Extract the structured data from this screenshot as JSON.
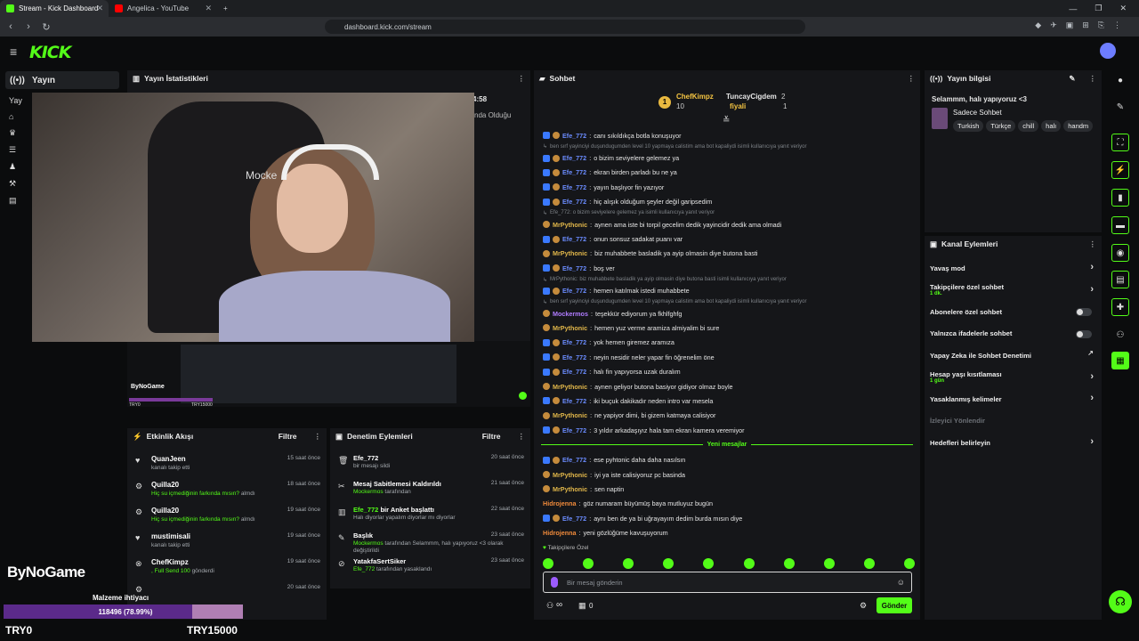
{
  "browser": {
    "tabs": [
      {
        "title": "Stream - Kick Dashboard",
        "color": "#53fc18"
      },
      {
        "title": "Angelica - YouTube",
        "color": "#ff0000"
      }
    ],
    "url": "dashboard.kick.com/stream"
  },
  "header": {
    "logo": "KICK"
  },
  "leftnav": {
    "active": "Yayın",
    "label": "Yay"
  },
  "stats": {
    "title": "Yayın İstatistikleri",
    "time": "4:58",
    "partial_label": "nda Olduğu"
  },
  "preview": {
    "brand": "ByNoGame",
    "left": "TRY0",
    "right": "TRY15000"
  },
  "activity": {
    "title": "Etkinlik Akışı",
    "filter": "Filtre",
    "items": [
      {
        "icon": "heart-icon",
        "glyph": "♥",
        "name": "QuanJeen",
        "sub": "kanalı takip etti",
        "sub_green": "",
        "time": "15 saat önce"
      },
      {
        "icon": "gift-icon",
        "glyph": "⚙",
        "name": "Quilla20",
        "sub": "almdı",
        "sub_green": "Hiç su içmediğinin farkında mısın?",
        "time": "18 saat önce"
      },
      {
        "icon": "gift-icon",
        "glyph": "⚙",
        "name": "Quilla20",
        "sub": "almdı",
        "sub_green": "Hiç su içmediğinin farkında mısın?",
        "time": "19 saat önce"
      },
      {
        "icon": "heart-icon",
        "glyph": "♥",
        "name": "mustimisali",
        "sub": "kanalı takip etti",
        "sub_green": "",
        "time": "19 saat önce"
      },
      {
        "icon": "x-circle-icon",
        "glyph": "⊗",
        "name": "ChefKimpz",
        "sub": "gönderdi",
        "sub_green": ", Full Send",
        "coins": "100",
        "time": "19 saat önce"
      },
      {
        "icon": "gift-icon",
        "glyph": "⚙",
        "name": "",
        "sub": "",
        "sub_green": "",
        "time": "20 saat önce"
      }
    ]
  },
  "moderation": {
    "title": "Denetim Eylemleri",
    "filter": "Filtre",
    "items": [
      {
        "icon": "trash-icon",
        "glyph": "🗑",
        "name": "Efe_772",
        "name_green": "",
        "sub": "bir mesajı sildi",
        "sub_green": "",
        "time": "20 saat önce"
      },
      {
        "icon": "pin-off-icon",
        "glyph": "✂",
        "name": "Mesaj Sabitlemesi Kaldırıldı",
        "name_green": "",
        "sub": "tarafından",
        "sub_green": "Mockermos",
        "time": "21 saat önce"
      },
      {
        "icon": "poll-icon",
        "glyph": "▥",
        "name": " bir Anket başlattı",
        "name_green": "Efe_772",
        "sub": "Halı diyorlar yapalım diyorlar mı diyorlar",
        "sub_green": "",
        "time": "22 saat önce"
      },
      {
        "icon": "pin-icon",
        "glyph": "✎",
        "name": "Başlık",
        "name_green": "",
        "sub": "tarafından Selammm, halı yapıyoruz <3 olarak değiştirildi",
        "sub_green": "Mockermos",
        "time": "23 saat önce"
      },
      {
        "icon": "ban-icon",
        "glyph": "⊘",
        "name": "YatakfaSertSiker",
        "name_green": "",
        "sub": "tarafından yasaklandı",
        "sub_green": "Efe_772",
        "time": "23 saat önce"
      }
    ]
  },
  "chat": {
    "title": "Sohbet",
    "leaderboard": [
      {
        "name": "ChefKimpz",
        "value": "10",
        "color": "#f5c542"
      },
      {
        "name": "TuncayCigdem",
        "value": "2",
        "color": "#e6e6e6"
      },
      {
        "name": "fiyali",
        "value": "1",
        "color": "#f5c542"
      }
    ],
    "messages": [
      {
        "type": "msg",
        "badges": 2,
        "user": "Efe_772",
        "color": "#6b8cff",
        "text": "canı sıkıldıkça botla konuşuyor"
      },
      {
        "type": "reply",
        "text": "ben sırf yayinciyi duşundugumden level 10 yapmaya calistim ama bot kapaliydi isimli kullanıcıya yanıt veriyor"
      },
      {
        "type": "msg",
        "badges": 2,
        "user": "Efe_772",
        "color": "#6b8cff",
        "text": "o bizim seviyelere gelemez ya"
      },
      {
        "type": "msg",
        "badges": 2,
        "user": "Efe_772",
        "color": "#6b8cff",
        "text": "ekran birden parladı bu ne ya"
      },
      {
        "type": "msg",
        "badges": 2,
        "user": "Efe_772",
        "color": "#6b8cff",
        "text": "yayın başlıyor fin yazıyor"
      },
      {
        "type": "msg",
        "badges": 2,
        "user": "Efe_772",
        "color": "#6b8cff",
        "text": "hiç alışık olduğum şeyler değil garipsedim"
      },
      {
        "type": "reply",
        "text": "Efe_772: o bizim seviyelere gelemez ya isimli kullanıcıya yanıt veriyor"
      },
      {
        "type": "msg",
        "badges": 1,
        "user": "MrPythonic",
        "color": "#e0b64a",
        "text": "aynen ama iste bi torpil gecelim dedik yayincidir dedik ama olmadi"
      },
      {
        "type": "msg",
        "badges": 2,
        "user": "Efe_772",
        "color": "#6b8cff",
        "text": "onun sonsuz sadakat puanı var"
      },
      {
        "type": "msg",
        "badges": 1,
        "user": "MrPythonic",
        "color": "#e0b64a",
        "text": "biz muhabbete basladik ya ayip olmasin diye butona basti"
      },
      {
        "type": "msg",
        "badges": 2,
        "user": "Efe_772",
        "color": "#6b8cff",
        "text": "boş ver"
      },
      {
        "type": "reply",
        "text": "MrPythonic: biz muhabbete basladik ya ayip olmasin diye butona basti isimli kullanıcıya yanıt veriyor"
      },
      {
        "type": "msg",
        "badges": 2,
        "user": "Efe_772",
        "color": "#6b8cff",
        "text": "hemen katılmak istedi muhabbete"
      },
      {
        "type": "reply",
        "text": "ben sırf yayinciyi duşundugumden level 10 yapmaya calistim ama bot kapaliydi isimli kullanıcıya yanıt veriyor"
      },
      {
        "type": "msg",
        "badges": 1,
        "user": "Mockermos",
        "color": "#b07cff",
        "text": "teşekkür ediyorum ya fkhlfghfg"
      },
      {
        "type": "msg",
        "badges": 1,
        "user": "MrPythonic",
        "color": "#e0b64a",
        "text": "hemen yuz verme aramiza almiyalim bi sure"
      },
      {
        "type": "msg",
        "badges": 2,
        "user": "Efe_772",
        "color": "#6b8cff",
        "text": "yok hemen giremez aramıza"
      },
      {
        "type": "msg",
        "badges": 2,
        "user": "Efe_772",
        "color": "#6b8cff",
        "text": "neyin nesidir neler yapar fin öğrenelim öne"
      },
      {
        "type": "msg",
        "badges": 2,
        "user": "Efe_772",
        "color": "#6b8cff",
        "text": "halı fin yapıyorsa uzak duralım"
      },
      {
        "type": "msg",
        "badges": 1,
        "user": "MrPythonic",
        "color": "#e0b64a",
        "text": "aynen geliyor butona basiyor gidiyor olmaz boyle"
      },
      {
        "type": "msg",
        "badges": 2,
        "user": "Efe_772",
        "color": "#6b8cff",
        "text": "iki buçuk dakikadır neden intro var mesela"
      },
      {
        "type": "msg",
        "badges": 1,
        "user": "MrPythonic",
        "color": "#e0b64a",
        "text": "ne yapiyor dimi, bi gizem katmaya calisiyor"
      },
      {
        "type": "msg",
        "badges": 2,
        "user": "Efe_772",
        "color": "#6b8cff",
        "text": "3 yıldır arkadaşıyız hala tam ekran kamera veremiyor"
      },
      {
        "type": "divider",
        "text": "Yeni mesajlar"
      },
      {
        "type": "msg",
        "badges": 2,
        "user": "Efe_772",
        "color": "#6b8cff",
        "text": "ese pyhtonic daha daha nasılsın"
      },
      {
        "type": "msg",
        "badges": 1,
        "user": "MrPythonic",
        "color": "#e0b64a",
        "text": "iyi ya iste calisiyoruz pc basinda"
      },
      {
        "type": "msg",
        "badges": 1,
        "user": "MrPythonic",
        "color": "#e0b64a",
        "text": "sen naptin"
      },
      {
        "type": "msg",
        "badges": 0,
        "user": "Hidrojenna",
        "color": "#f08a3a",
        "text": "göz numaram büyümüş baya mutluyuz bugün"
      },
      {
        "type": "msg",
        "badges": 2,
        "user": "Efe_772",
        "color": "#6b8cff",
        "text": "aynı ben de ya bi uğrayayım dedim burda mısın diye"
      },
      {
        "type": "msg",
        "badges": 0,
        "user": "Hidrojenna",
        "color": "#f08a3a",
        "text": "yeni gözlüğüme kavuşuyorum"
      }
    ],
    "followers_only": "Takipçilere Özel",
    "input_placeholder": "Bir mesaj gönderin",
    "infinity": "∞",
    "count": "0",
    "send": "Gönder"
  },
  "info": {
    "title": "Yayın bilgisi",
    "stream_title": "Selammm, halı yapıyoruz <3",
    "category": "Sadece Sohbet",
    "tags": [
      "Turkish",
      "Türkçe",
      "chill",
      "halı",
      "handm"
    ]
  },
  "actions": {
    "title": "Kanal Eylemleri",
    "items": [
      {
        "label": "Yavaş mod",
        "sub": "",
        "control": "chevron"
      },
      {
        "label": "Takipçilere özel sohbet",
        "sub": "1 dk.",
        "control": "chevron"
      },
      {
        "label": "Abonelere özel sohbet",
        "sub": "",
        "control": "toggle"
      },
      {
        "label": "Yalnızca ifadelerle sohbet",
        "sub": "",
        "control": "toggle"
      },
      {
        "label": "Yapay Zeka ile Sohbet Denetimi",
        "sub": "",
        "control": "external"
      },
      {
        "label": "Hesap yaşı kısıtlaması",
        "sub": "1 gün",
        "control": "chevron"
      },
      {
        "label": "Yasaklanmış kelimeler",
        "sub": "",
        "control": "chevron"
      },
      {
        "label": "İzleyici Yönlendir",
        "sub": "",
        "control": "disabled"
      },
      {
        "label": "Hedefleri belirleyin",
        "sub": "",
        "control": "chevron"
      }
    ]
  },
  "overlay": {
    "brand": "ByNoGame",
    "goal_label": "Malzeme ihtiyacı",
    "goal_text": "118496 (78.99%)",
    "goal_progress": 0.7899,
    "left": "TRY0",
    "right": "TRY15000"
  },
  "colors": {
    "accent": "#53fc18",
    "panel": "#151619",
    "bg": "#0b0c0d"
  }
}
